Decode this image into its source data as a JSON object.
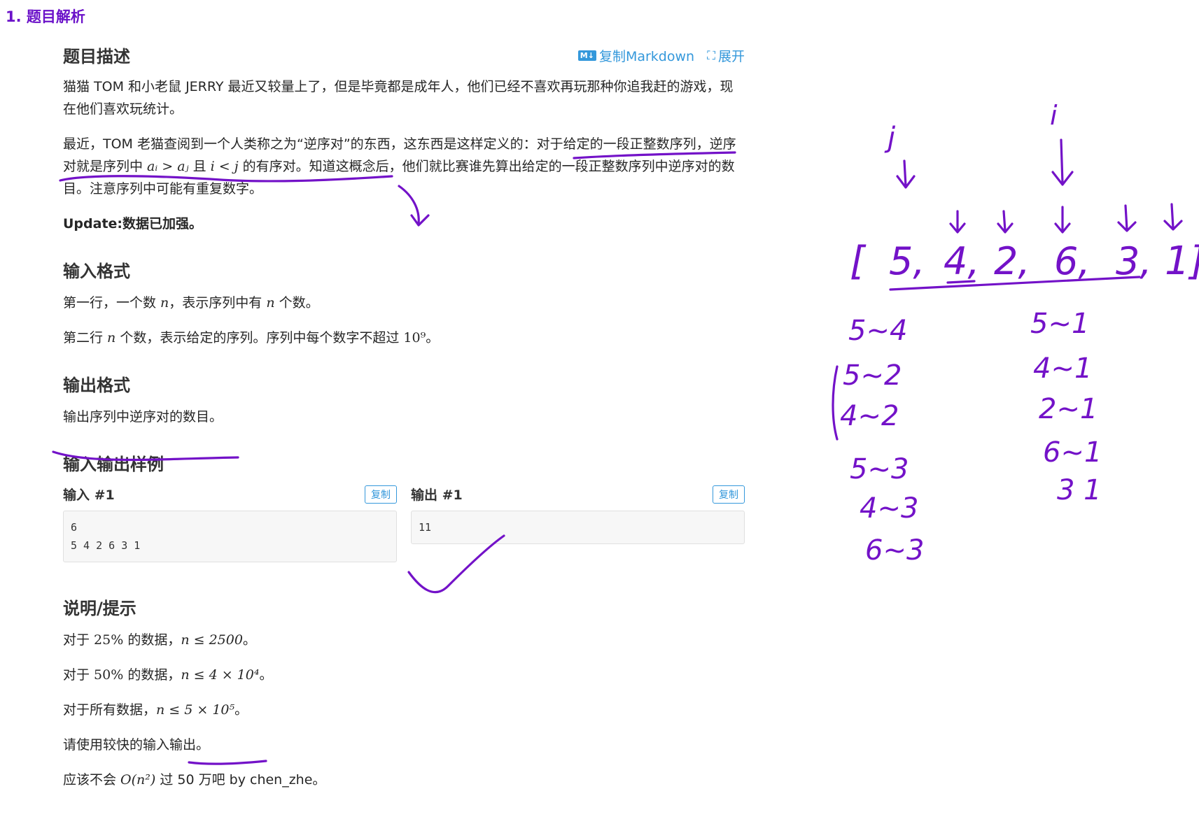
{
  "section_heading": "1. 题目解析",
  "problem": {
    "title": "题目描述",
    "actions": {
      "copy_markdown": "复制Markdown",
      "expand": "展开",
      "md_icon": "M↓",
      "expand_icon": "⛶"
    },
    "desc_p1": "猫猫 TOM 和小老鼠 JERRY 最近又较量上了，但是毕竟都是成年人，他们已经不喜欢再玩那种你追我赶的游戏，现在他们喜欢玩统计。",
    "desc_p2": {
      "prefix": "最近，TOM 老猫查阅到一个人类称之为“逆序对”的东西，这东西是这样定义的：对于给定的一段正整数序列，逆序对就是序列中 ",
      "math1": "aᵢ > aⱼ",
      "mid": " 且 ",
      "math2": "i < j",
      "suffix": " 的有序对。知道这概念后，他们就比赛谁先算出给定的一段正整数序列中逆序对的数目。注意序列中可能有重复数字。"
    },
    "update": "Update:数据已加强。",
    "input_heading": "输入格式",
    "input_line1": {
      "a": "第一行，一个数 ",
      "n1": "n",
      "b": "，表示序列中有 ",
      "n2": "n",
      "c": " 个数。"
    },
    "input_line2": {
      "a": "第二行 ",
      "n": "n",
      "b": " 个数，表示给定的序列。序列中每个数字不超过 ",
      "pow": "10⁹",
      "c": "。"
    },
    "output_heading": "输出格式",
    "output_line": "输出序列中逆序对的数目。",
    "samples_heading": "输入输出样例",
    "sample_input_label": "输入 #1",
    "sample_output_label": "输出 #1",
    "copy_label": "复制",
    "sample_input": "6\n5 4 2 6 3 1",
    "sample_output": "11",
    "hints_heading": "说明/提示",
    "hint1": {
      "a": "对于 ",
      "pct": "25%",
      "b": " 的数据，",
      "m": "n ≤ 2500",
      "c": "。"
    },
    "hint2": {
      "a": "对于 ",
      "pct": "50%",
      "b": " 的数据，",
      "m": "n ≤ 4 × 10⁴",
      "c": "。"
    },
    "hint3": {
      "a": "对于所有数据，",
      "m": "n ≤ 5 × 10⁵",
      "c": "。"
    },
    "hint4": "请使用较快的输入输出。",
    "hint5": {
      "a": "应该不会 ",
      "m": "O(n²)",
      "b": " 过 50 万吧 by chen_zhe。"
    }
  },
  "handwriting": {
    "label_j": "j",
    "label_i": "i",
    "array": [
      "[",
      "5,",
      "4,",
      "2,",
      "6,",
      "3,",
      "1]"
    ],
    "pairs_left": [
      "5~4",
      "5~2",
      "4~2",
      "5~3",
      "4~3",
      "6~3"
    ],
    "pairs_right": [
      "5~1",
      "4~1",
      "2~1",
      "6~1",
      "3 1"
    ],
    "ink_color": "#7312c8"
  }
}
